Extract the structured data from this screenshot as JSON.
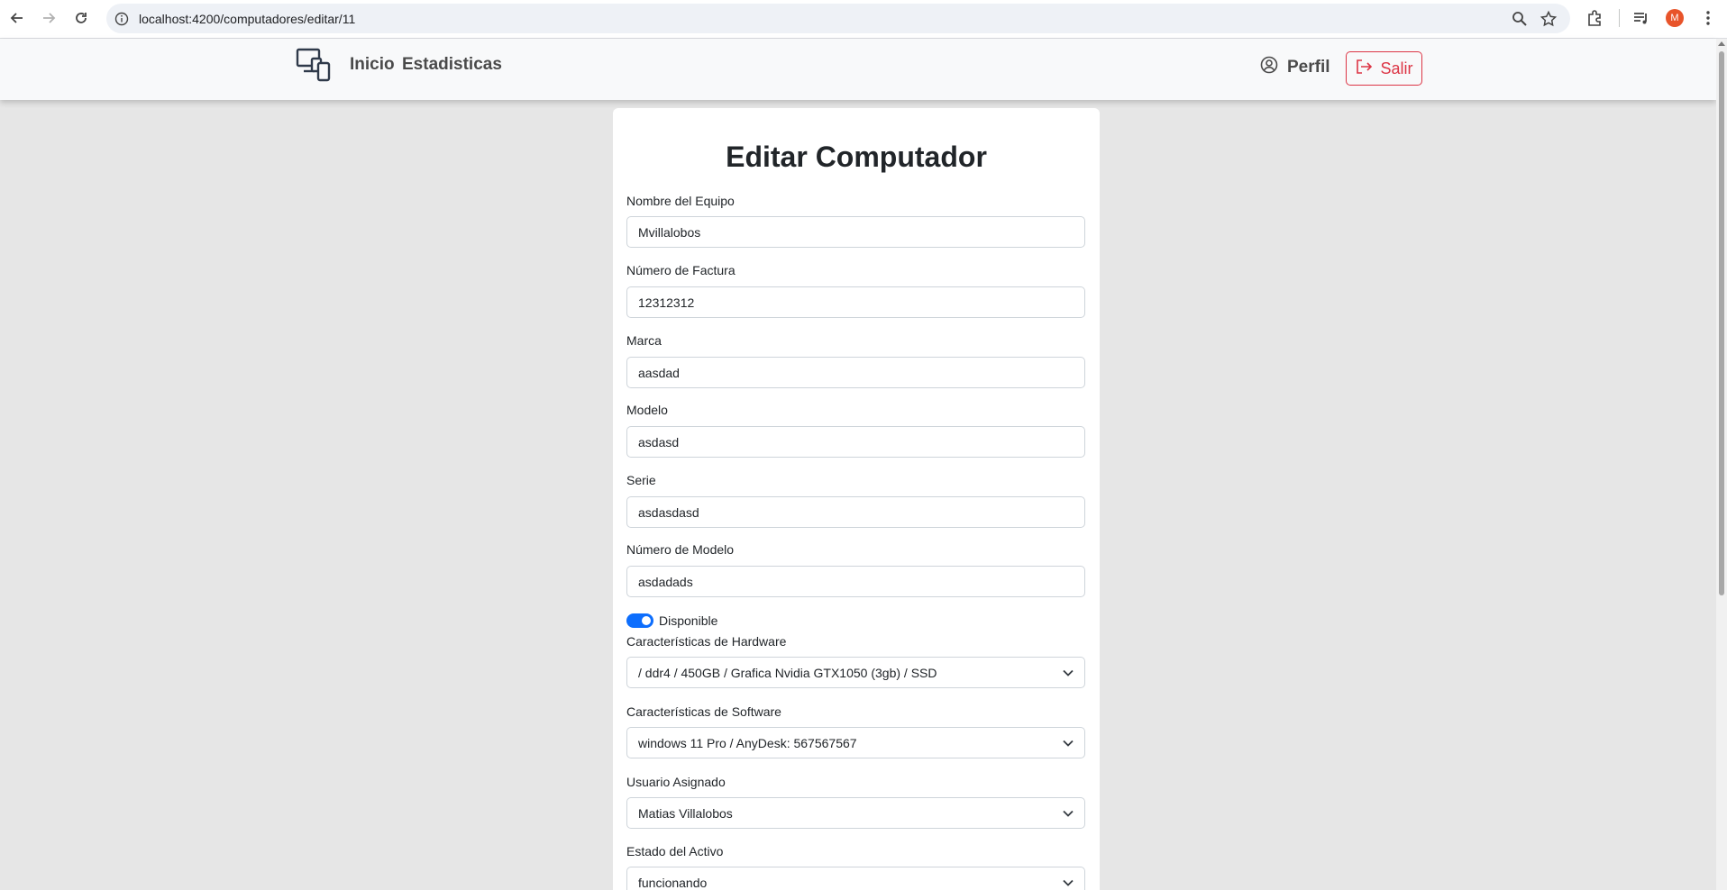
{
  "browser": {
    "url": "localhost:4200/computadores/editar/11",
    "profile_initial": "M"
  },
  "navbar": {
    "links": [
      "Inicio",
      "Estadisticas"
    ],
    "perfil_label": "Perfil",
    "salir_label": "Salir",
    "salir_color": "#dc3545"
  },
  "form": {
    "title": "Editar Computador",
    "nombre_label": "Nombre del Equipo",
    "nombre_value": "Mvillalobos",
    "factura_label": "Número de Factura",
    "factura_value": "12312312",
    "marca_label": "Marca",
    "marca_value": "aasdad",
    "modelo_label": "Modelo",
    "modelo_value": "asdasd",
    "serie_label": "Serie",
    "serie_value": "asdasdasd",
    "num_modelo_label": "Número de Modelo",
    "num_modelo_value": "asdadads",
    "disponible_label": "Disponible",
    "disponible_on": true,
    "hardware_label": "Características de Hardware",
    "hardware_value": "/ ddr4 / 450GB / Grafica Nvidia GTX1050 (3gb) / SSD",
    "software_label": "Características de Software",
    "software_value": "windows 11 Pro / AnyDesk: 567567567",
    "usuario_label": "Usuario Asignado",
    "usuario_value": "Matias Villalobos",
    "estado_label": "Estado del Activo",
    "estado_value": "funcionando"
  },
  "colors": {
    "accent": "#0d6efd",
    "danger": "#dc3545",
    "page_bg": "#e6e6e6"
  }
}
